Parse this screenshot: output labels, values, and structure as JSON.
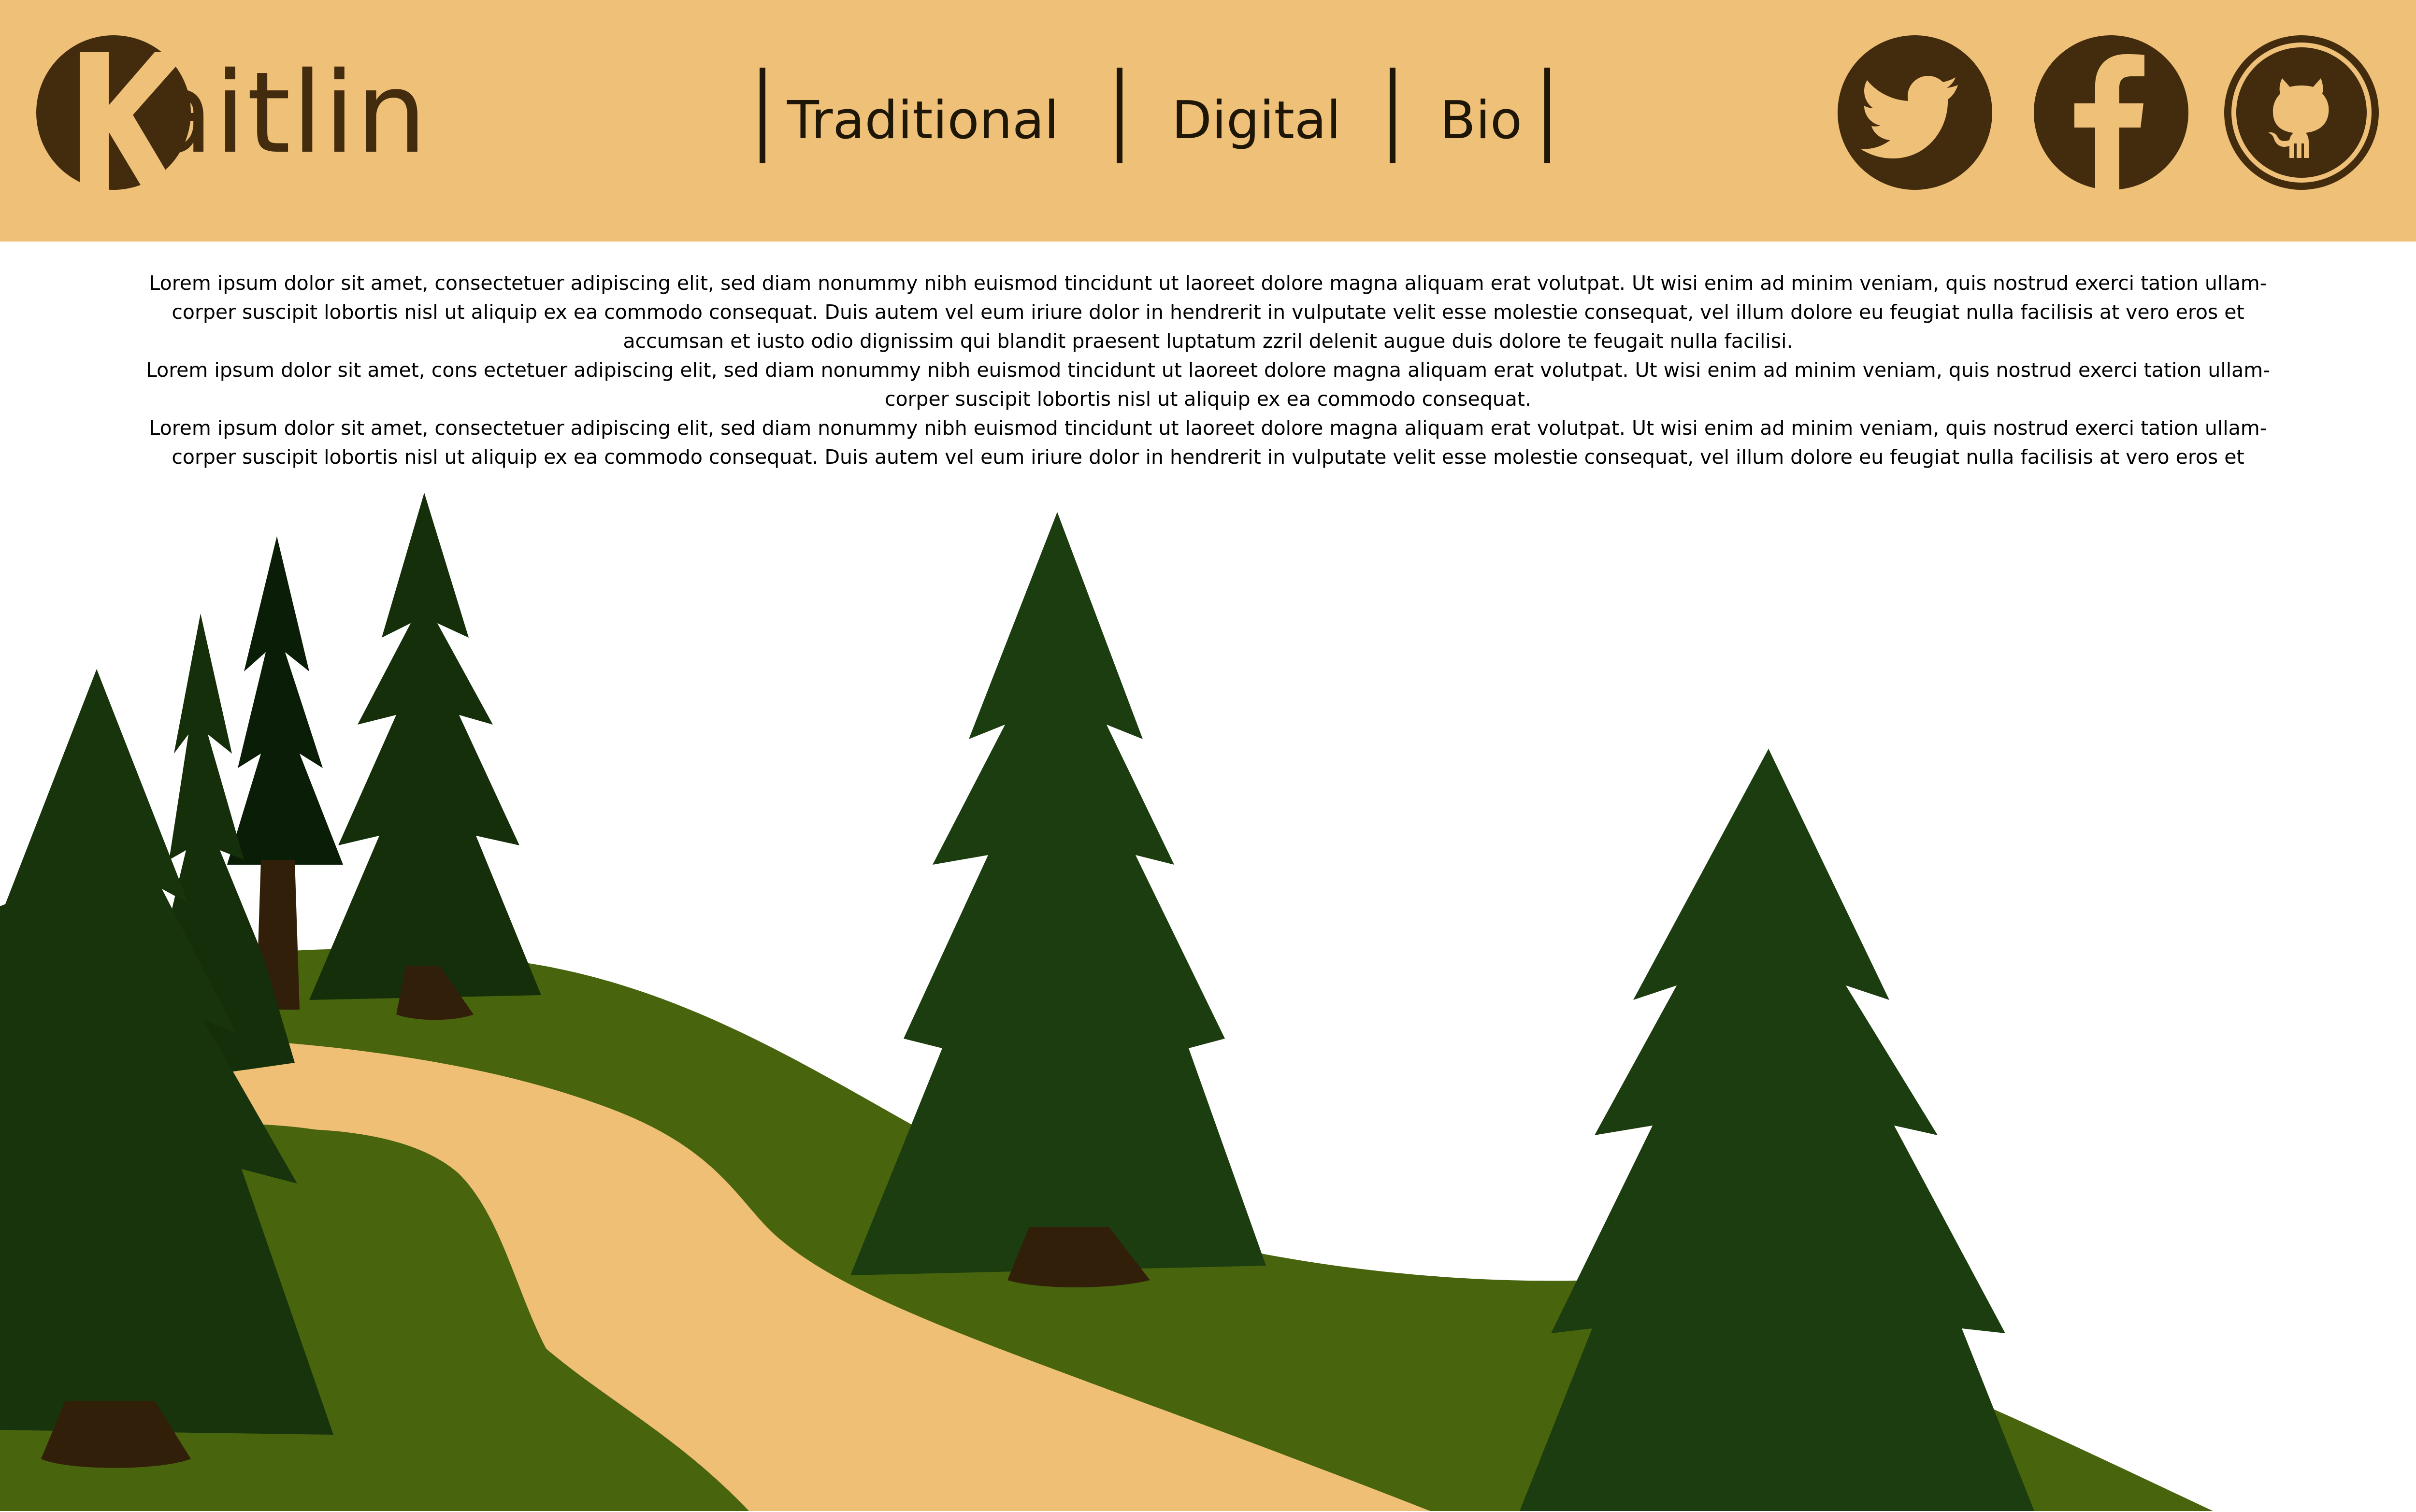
{
  "site": {
    "logo_text": "aitlin",
    "logo_initial": "K"
  },
  "nav": {
    "items": [
      {
        "label": "Traditional"
      },
      {
        "label": "Digital"
      },
      {
        "label": "Bio"
      }
    ]
  },
  "social": [
    {
      "icon": "twitter-icon"
    },
    {
      "icon": "facebook-icon"
    },
    {
      "icon": "github-icon"
    }
  ],
  "content": {
    "lines": [
      "Lorem ipsum dolor sit amet, consectetuer adipiscing elit, sed diam nonummy nibh euismod tincidunt ut laoreet dolore magna aliquam erat volutpat. Ut wisi enim ad minim veniam, quis nostrud exerci tation ullam-",
      "corper suscipit lobortis nisl ut aliquip ex ea commodo consequat. Duis autem vel eum iriure dolor in hendrerit in vulputate velit esse molestie consequat, vel illum dolore eu feugiat nulla facilisis at vero eros et",
      "accumsan et iusto odio dignissim qui blandit praesent luptatum zzril delenit augue duis dolore te feugait nulla facilisi.",
      "Lorem ipsum dolor sit amet, cons ectetuer adipiscing elit, sed diam nonummy nibh euismod tincidunt ut laoreet dolore magna aliquam erat volutpat. Ut wisi enim ad minim veniam, quis nostrud exerci tation ullam-",
      "corper suscipit lobortis nisl ut aliquip ex ea commodo consequat.",
      "Lorem ipsum dolor sit amet, consectetuer adipiscing elit, sed diam nonummy nibh euismod tincidunt ut laoreet dolore magna aliquam erat volutpat. Ut wisi enim ad minim veniam, quis nostrud exerci tation ullam-",
      "corper suscipit lobortis nisl ut aliquip ex ea commodo consequat. Duis autem vel eum iriure dolor in hendrerit in vulputate velit esse molestie consequat, vel illum dolore eu feugiat nulla facilisis at vero eros et"
    ]
  },
  "colors": {
    "header_bg": "#efc077",
    "brand_brown": "#432c0e",
    "nav_text": "#1e1607",
    "hill_green": "#48650d",
    "path_tan": "#eebf75",
    "tree_dark": "#123009",
    "tree_green": "#1c3d0f",
    "trunk": "#311f0a"
  }
}
